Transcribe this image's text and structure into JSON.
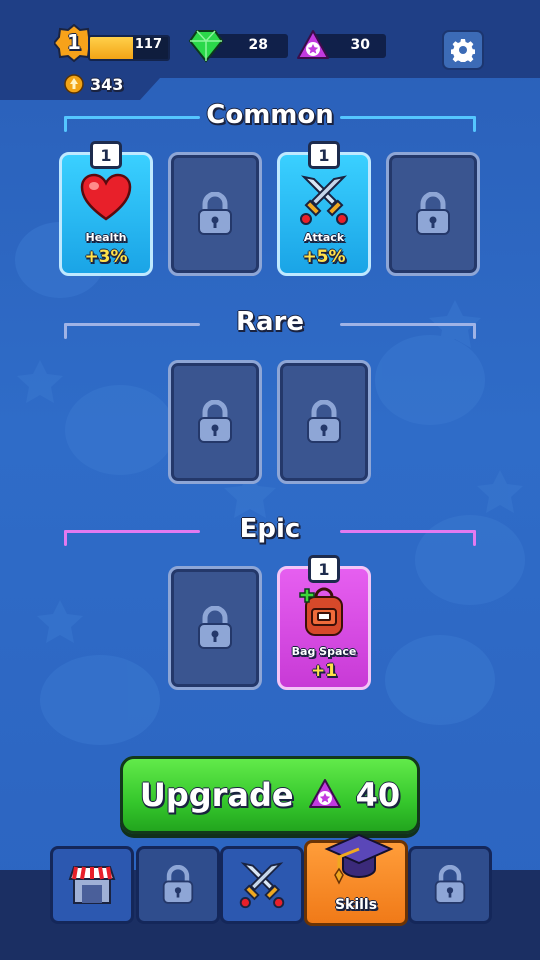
{
  "header": {
    "level": "1",
    "xp_value": "117",
    "xp_progress": 0.55,
    "gems": "28",
    "tokens": "30",
    "coins": "343"
  },
  "sections": {
    "common": {
      "title": "Common",
      "color": "#55c6ff"
    },
    "rare": {
      "title": "Rare",
      "color": "#9fb3e6"
    },
    "epic": {
      "title": "Epic",
      "color": "#e27af0"
    }
  },
  "cards": {
    "health": {
      "count": "1",
      "name": "Health",
      "bonus": "+3%"
    },
    "attack": {
      "count": "1",
      "name": "Attack",
      "bonus": "+5%"
    },
    "bag_space": {
      "count": "1",
      "name": "Bag Space",
      "bonus": "+1"
    }
  },
  "upgrade": {
    "label": "Upgrade",
    "cost": "40"
  },
  "nav": {
    "skills_label": "Skills",
    "items": [
      "shop-icon",
      "lock-icon",
      "swords-icon",
      "graduation-cap-icon",
      "lock-icon"
    ]
  }
}
